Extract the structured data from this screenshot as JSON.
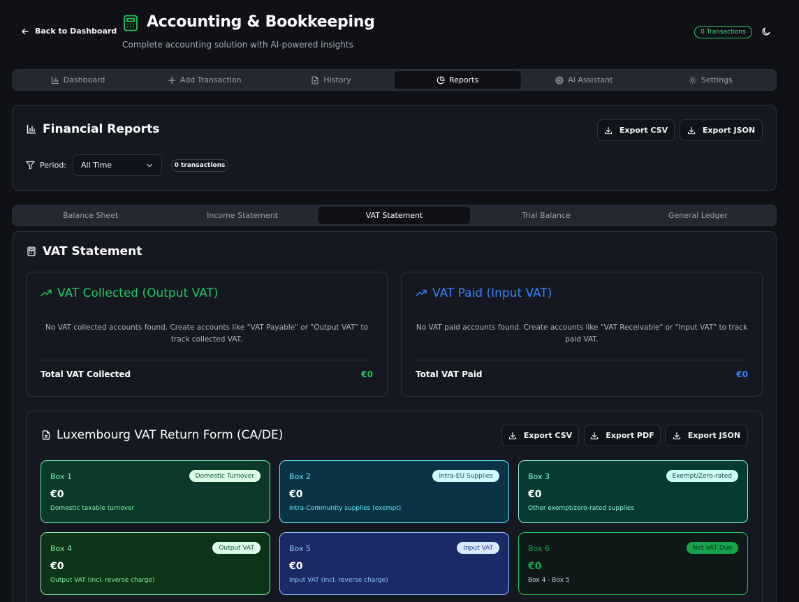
{
  "header": {
    "back_label": "Back to Dashboard",
    "title": "Accounting & Bookkeeping",
    "subtitle": "Complete accounting solution with AI-powered insights",
    "transactions_badge": "0 Transactions"
  },
  "main_tabs": [
    {
      "label": "Dashboard",
      "icon": "bar-chart-icon",
      "active": false
    },
    {
      "label": "Add Transaction",
      "icon": "plus-icon",
      "active": false
    },
    {
      "label": "History",
      "icon": "file-icon",
      "active": false
    },
    {
      "label": "Reports",
      "icon": "pie-chart-icon",
      "active": true
    },
    {
      "label": "AI Assistant",
      "icon": "target-icon",
      "active": false
    },
    {
      "label": "Settings",
      "icon": "gear-icon",
      "active": false
    }
  ],
  "financial_reports": {
    "title": "Financial Reports",
    "export_csv": "Export CSV",
    "export_json": "Export JSON",
    "period_label": "Period:",
    "period_value": "All Time",
    "transaction_count": "0 transactions"
  },
  "report_tabs": [
    {
      "label": "Balance Sheet",
      "active": false
    },
    {
      "label": "Income Statement",
      "active": false
    },
    {
      "label": "VAT Statement",
      "active": true
    },
    {
      "label": "Trial Balance",
      "active": false
    },
    {
      "label": "General Ledger",
      "active": false
    }
  ],
  "vat_statement": {
    "title": "VAT Statement",
    "collected": {
      "title": "VAT Collected (Output VAT)",
      "message": "No VAT collected accounts found. Create accounts like \"VAT Payable\" or \"Output VAT\" to track collected VAT.",
      "total_label": "Total VAT Collected",
      "total_value": "€0",
      "color": "#22c55e"
    },
    "paid": {
      "title": "VAT Paid (Input VAT)",
      "message": "No VAT paid accounts found. Create accounts like \"VAT Receivable\" or \"Input VAT\" to track paid VAT.",
      "total_label": "Total VAT Paid",
      "total_value": "€0",
      "color": "#3b82f6"
    }
  },
  "lux_form": {
    "title": "Luxembourg VAT Return Form (CA/DE)",
    "export_csv": "Export CSV",
    "export_pdf": "Export PDF",
    "export_json": "Export JSON",
    "boxes": [
      {
        "label": "Box 1",
        "badge": "Domestic Turnover",
        "value": "€0",
        "desc": "Domestic taxable turnover"
      },
      {
        "label": "Box 2",
        "badge": "Intra-EU Supplies",
        "value": "€0",
        "desc": "Intra-Community supplies (exempt)"
      },
      {
        "label": "Box 3",
        "badge": "Exempt/Zero-rated",
        "value": "€0",
        "desc": "Other exempt/zero-rated supplies"
      },
      {
        "label": "Box 4",
        "badge": "Output VAT",
        "value": "€0",
        "desc": "Output VAT (incl. reverse charge)"
      },
      {
        "label": "Box 5",
        "badge": "Input VAT",
        "value": "€0",
        "desc": "Input VAT (incl. reverse charge)"
      },
      {
        "label": "Box 6",
        "badge": "Net VAT Due",
        "value": "€0",
        "desc": "Box 4 - Box 5"
      }
    ]
  }
}
